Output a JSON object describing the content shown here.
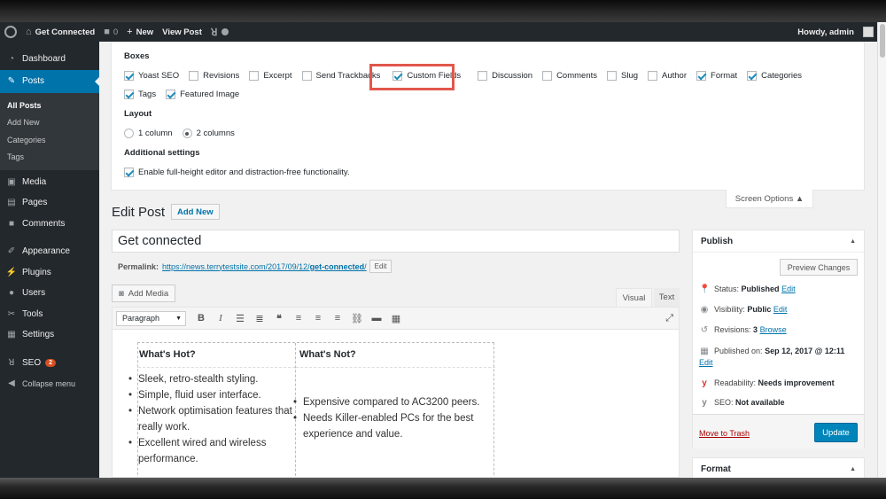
{
  "adminbar": {
    "site_name": "Get Connected",
    "comments_count": "0",
    "new_label": "New",
    "view_post": "View Post",
    "howdy": "Howdy, admin"
  },
  "sidebar": {
    "items": [
      {
        "label": "Dashboard",
        "icon": "dashboard-icon"
      },
      {
        "label": "Posts",
        "icon": "pin-icon"
      },
      {
        "label": "Media",
        "icon": "media-icon"
      },
      {
        "label": "Pages",
        "icon": "pages-icon"
      },
      {
        "label": "Comments",
        "icon": "comments-icon"
      },
      {
        "label": "Appearance",
        "icon": "brush-icon"
      },
      {
        "label": "Plugins",
        "icon": "plug-icon"
      },
      {
        "label": "Users",
        "icon": "users-icon"
      },
      {
        "label": "Tools",
        "icon": "wrench-icon"
      },
      {
        "label": "Settings",
        "icon": "settings-icon"
      },
      {
        "label": "SEO",
        "icon": "yoast-icon",
        "badge": "2"
      },
      {
        "label": "Collapse menu",
        "icon": "collapse-icon"
      }
    ],
    "posts_submenu": [
      "All Posts",
      "Add New",
      "Categories",
      "Tags"
    ]
  },
  "screen_options": {
    "boxes_heading": "Boxes",
    "boxes": [
      {
        "label": "Yoast SEO",
        "checked": true
      },
      {
        "label": "Revisions",
        "checked": false
      },
      {
        "label": "Excerpt",
        "checked": false
      },
      {
        "label": "Send Trackbacks",
        "checked": false
      },
      {
        "label": "Custom Fields",
        "checked": true
      },
      {
        "label": "Discussion",
        "checked": false
      },
      {
        "label": "Comments",
        "checked": false
      },
      {
        "label": "Slug",
        "checked": false
      },
      {
        "label": "Author",
        "checked": false
      },
      {
        "label": "Format",
        "checked": true
      },
      {
        "label": "Categories",
        "checked": true
      },
      {
        "label": "Tags",
        "checked": true
      },
      {
        "label": "Featured Image",
        "checked": true
      }
    ],
    "layout_heading": "Layout",
    "layout_options": [
      {
        "label": "1 column",
        "checked": false
      },
      {
        "label": "2 columns",
        "checked": true
      }
    ],
    "additional_heading": "Additional settings",
    "additional_option": "Enable full-height editor and distraction-free functionality.",
    "toggle_label": "Screen Options ▲"
  },
  "editor": {
    "page_title": "Edit Post",
    "add_new": "Add New",
    "post_title": "Get connected",
    "permalink_label": "Permalink:",
    "permalink_base": "https://news.terrytestsite.com/2017/09/12/",
    "permalink_slug": "get-connected",
    "permalink_end": "/",
    "edit_label": "Edit",
    "add_media": "Add Media",
    "tab_visual": "Visual",
    "tab_text": "Text",
    "format_select": "Paragraph",
    "table": {
      "hot_head": "What's Hot?",
      "not_head": "What's Not?",
      "hot_items": [
        "Sleek, retro-stealth styling.",
        "Simple, fluid user interface.",
        "Network optimisation features that really work.",
        "Excellent wired and wireless performance."
      ],
      "not_items": [
        "Expensive compared to AC3200 peers.",
        "Needs Killer-enabled PCs for the best experience and value."
      ]
    }
  },
  "publish": {
    "heading": "Publish",
    "preview": "Preview Changes",
    "status_label": "Status:",
    "status_value": "Published",
    "visibility_label": "Visibility:",
    "visibility_value": "Public",
    "revisions_label": "Revisions:",
    "revisions_value": "3",
    "browse": "Browse",
    "published_on_label": "Published on:",
    "published_on_value": "Sep 12, 2017 @ 12:11",
    "readability_label": "Readability:",
    "readability_value": "Needs improvement",
    "seo_label": "SEO:",
    "seo_value": "Not available",
    "trash": "Move to Trash",
    "update": "Update",
    "edit": "Edit"
  },
  "format_box": {
    "heading": "Format"
  },
  "colors": {
    "accent": "#0073aa",
    "sidebar_bg": "#23282d",
    "highlight": "#e2574c",
    "update_button": "#0085ba"
  }
}
